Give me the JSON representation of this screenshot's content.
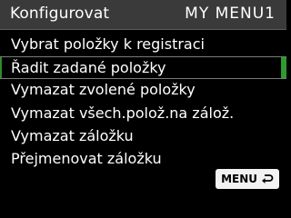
{
  "header": {
    "title": "Konfigurovat",
    "tab_label": "MY MENU1"
  },
  "menu": {
    "items": [
      {
        "label": "Vybrat položky k registraci",
        "selected": false
      },
      {
        "label": "Řadit zadané položky",
        "selected": true
      },
      {
        "label": "Vymazat zvolené položky",
        "selected": false
      },
      {
        "label": "Vymazat všech.polož.na zálož.",
        "selected": false
      },
      {
        "label": "Vymazat záložku",
        "selected": false
      },
      {
        "label": "Přejmenovat záložku",
        "selected": false
      }
    ]
  },
  "footer": {
    "menu_button_label": "MENU",
    "return_icon": "return-icon"
  },
  "colors": {
    "header_bg": "#3a3a3a",
    "background": "#000000",
    "selection_accent": "#2f9a2f",
    "text": "#ffffff"
  }
}
